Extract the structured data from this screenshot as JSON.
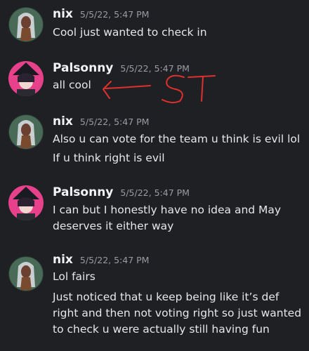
{
  "messages": [
    {
      "user": "nix",
      "time": "5/5/22, 5:47 PM",
      "lines": [
        "Cool just wanted to check in"
      ]
    },
    {
      "user": "Palsonny",
      "time": "5/5/22, 5:47 PM",
      "lines": [
        "all cool"
      ]
    },
    {
      "user": "nix",
      "time": "5/5/22, 5:47 PM",
      "lines": [
        "Also u can vote for the team u think is evil lol",
        "If u think right is evil"
      ]
    },
    {
      "user": "Palsonny",
      "time": "5/5/22, 5:47 PM",
      "lines": [
        "I can but I honestly have no idea and May deserves it either way"
      ]
    },
    {
      "user": "nix",
      "time": "5/5/22, 5:47 PM",
      "lines": [
        "Lol fairs",
        "Just noticed that u keep being like it’s def right and then not voting right so just wanted to check u were actually still having fun"
      ]
    }
  ],
  "annotation": {
    "text": "ST",
    "color": "#e0302e"
  },
  "colors": {
    "background": "#1f2023",
    "username": "#f2f3f5",
    "timestamp": "#9a9ca3",
    "text": "#e6e7ea"
  }
}
